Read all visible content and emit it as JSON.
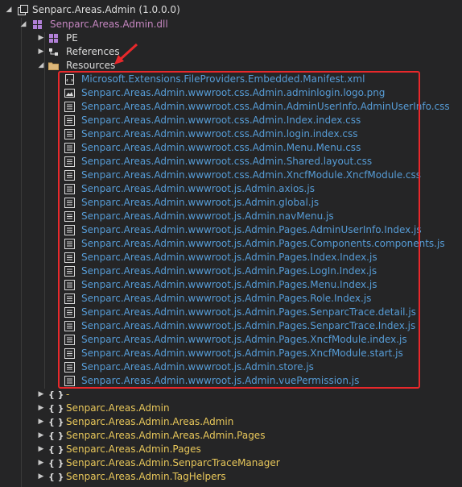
{
  "tree": {
    "project_title": "Senparc.Areas.Admin (1.0.0.0)",
    "dll_title": "Senparc.Areas.Admin.dll",
    "pe_label": "PE",
    "references_label": "References",
    "resources_label": "Resources",
    "resources": [
      {
        "label": "Microsoft.Extensions.FileProviders.Embedded.Manifest.xml",
        "icon": "xml-file-icon"
      },
      {
        "label": "Senparc.Areas.Admin.wwwroot.css.Admin.adminlogin.logo.png",
        "icon": "image-file-icon"
      },
      {
        "label": "Senparc.Areas.Admin.wwwroot.css.Admin.AdminUserInfo.AdminUserInfo.css",
        "icon": "resource-file-icon"
      },
      {
        "label": "Senparc.Areas.Admin.wwwroot.css.Admin.Index.index.css",
        "icon": "resource-file-icon"
      },
      {
        "label": "Senparc.Areas.Admin.wwwroot.css.Admin.login.index.css",
        "icon": "resource-file-icon"
      },
      {
        "label": "Senparc.Areas.Admin.wwwroot.css.Admin.Menu.Menu.css",
        "icon": "resource-file-icon"
      },
      {
        "label": "Senparc.Areas.Admin.wwwroot.css.Admin.Shared.layout.css",
        "icon": "resource-file-icon"
      },
      {
        "label": "Senparc.Areas.Admin.wwwroot.css.Admin.XncfModule.XncfModule.css",
        "icon": "resource-file-icon"
      },
      {
        "label": "Senparc.Areas.Admin.wwwroot.js.Admin.axios.js",
        "icon": "resource-file-icon"
      },
      {
        "label": "Senparc.Areas.Admin.wwwroot.js.Admin.global.js",
        "icon": "resource-file-icon"
      },
      {
        "label": "Senparc.Areas.Admin.wwwroot.js.Admin.navMenu.js",
        "icon": "resource-file-icon"
      },
      {
        "label": "Senparc.Areas.Admin.wwwroot.js.Admin.Pages.AdminUserInfo.Index.js",
        "icon": "resource-file-icon"
      },
      {
        "label": "Senparc.Areas.Admin.wwwroot.js.Admin.Pages.Components.components.js",
        "icon": "resource-file-icon"
      },
      {
        "label": "Senparc.Areas.Admin.wwwroot.js.Admin.Pages.Index.Index.js",
        "icon": "resource-file-icon"
      },
      {
        "label": "Senparc.Areas.Admin.wwwroot.js.Admin.Pages.LogIn.Index.js",
        "icon": "resource-file-icon"
      },
      {
        "label": "Senparc.Areas.Admin.wwwroot.js.Admin.Pages.Menu.Index.js",
        "icon": "resource-file-icon"
      },
      {
        "label": "Senparc.Areas.Admin.wwwroot.js.Admin.Pages.Role.Index.js",
        "icon": "resource-file-icon"
      },
      {
        "label": "Senparc.Areas.Admin.wwwroot.js.Admin.Pages.SenparcTrace.detail.js",
        "icon": "resource-file-icon"
      },
      {
        "label": "Senparc.Areas.Admin.wwwroot.js.Admin.Pages.SenparcTrace.Index.js",
        "icon": "resource-file-icon"
      },
      {
        "label": "Senparc.Areas.Admin.wwwroot.js.Admin.Pages.XncfModule.index.js",
        "icon": "resource-file-icon"
      },
      {
        "label": "Senparc.Areas.Admin.wwwroot.js.Admin.Pages.XncfModule.start.js",
        "icon": "resource-file-icon"
      },
      {
        "label": "Senparc.Areas.Admin.wwwroot.js.Admin.store.js",
        "icon": "resource-file-icon"
      },
      {
        "label": "Senparc.Areas.Admin.wwwroot.js.Admin.vuePermission.js",
        "icon": "resource-file-icon"
      }
    ],
    "namespaces": [
      {
        "label": "-"
      },
      {
        "label": "Senparc.Areas.Admin"
      },
      {
        "label": "Senparc.Areas.Admin.Areas.Admin"
      },
      {
        "label": "Senparc.Areas.Admin.Areas.Admin.Pages"
      },
      {
        "label": "Senparc.Areas.Admin.Pages"
      },
      {
        "label": "Senparc.Areas.Admin.SenparcTraceManager"
      },
      {
        "label": "Senparc.Areas.Admin.TagHelpers"
      }
    ]
  },
  "colors": {
    "background": "#252526",
    "resource_text": "#569cd6",
    "namespace_text": "#e8c75a",
    "highlight_border": "#e8282b",
    "annotation_arrow": "#e8282b"
  }
}
